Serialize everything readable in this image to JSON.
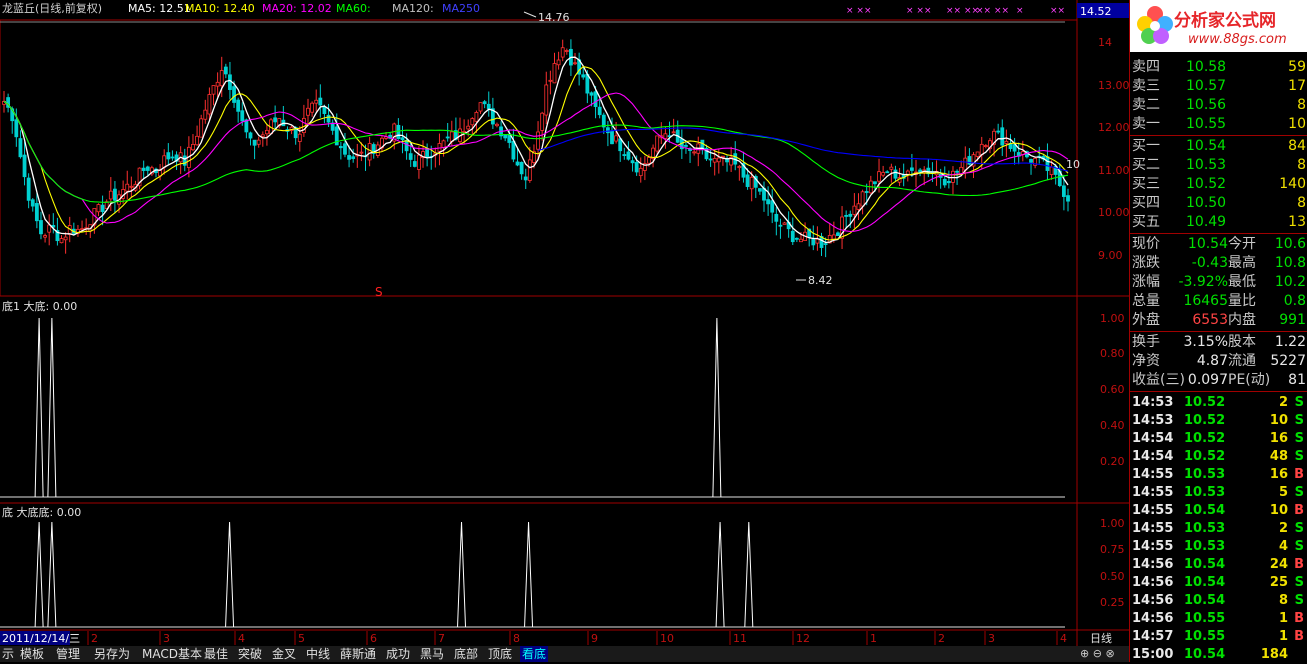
{
  "header": {
    "title": "龙蓝丘(日线,前复权)",
    "ma5": "MA5: 12.51",
    "ma10": "MA10: 12.40",
    "ma20": "MA20: 12.02",
    "ma60": "MA60:",
    "ma120": "MA120:",
    "ma250": "MA250",
    "price_box": "14.52"
  },
  "main_chart": {
    "y_ticks": [
      "14",
      "13.00",
      "12.00",
      "11.00",
      "10.00",
      "9.00"
    ],
    "high_label": "14.76",
    "low_label": "8.42",
    "right_label": "10",
    "s_marker": "S"
  },
  "sub1": {
    "title": "底1 大底: 0.00",
    "y_ticks": [
      "1.00",
      "0.80",
      "0.60",
      "0.40",
      "0.20"
    ]
  },
  "sub2": {
    "title": "底 大底底: 0.00",
    "y_ticks": [
      "1.00",
      "0.75",
      "0.50",
      "0.25"
    ]
  },
  "x_axis": {
    "date_box": "2011/12/14/三",
    "ticks": [
      "2",
      "3",
      "4",
      "5",
      "6",
      "7",
      "8",
      "9",
      "10",
      "11",
      "12",
      "1",
      "2",
      "3",
      "4"
    ],
    "period": "日线"
  },
  "logo": {
    "brand": "分析家公式网",
    "url": "www.88gs.com"
  },
  "order_book": {
    "asks": [
      {
        "label": "卖四",
        "price": "10.58",
        "vol": "59"
      },
      {
        "label": "卖三",
        "price": "10.57",
        "vol": "17"
      },
      {
        "label": "卖二",
        "price": "10.56",
        "vol": "8"
      },
      {
        "label": "卖一",
        "price": "10.55",
        "vol": "10"
      }
    ],
    "bids": [
      {
        "label": "买一",
        "price": "10.54",
        "vol": "84"
      },
      {
        "label": "买二",
        "price": "10.53",
        "vol": "8"
      },
      {
        "label": "买三",
        "price": "10.52",
        "vol": "140"
      },
      {
        "label": "买四",
        "price": "10.50",
        "vol": "8"
      },
      {
        "label": "买五",
        "price": "10.49",
        "vol": "13"
      }
    ]
  },
  "stats": [
    {
      "l1": "现价",
      "v1": "10.54",
      "l2": "今开",
      "v2": "10.6"
    },
    {
      "l1": "涨跌",
      "v1": "-0.43",
      "l2": "最高",
      "v2": "10.8"
    },
    {
      "l1": "涨幅",
      "v1": "-3.92%",
      "l2": "最低",
      "v2": "10.2"
    },
    {
      "l1": "总量",
      "v1": "16465",
      "l2": "量比",
      "v2": "0.8"
    },
    {
      "l1": "外盘",
      "v1": "6553",
      "l2": "内盘",
      "v2": "991"
    }
  ],
  "stats2": [
    {
      "l1": "换手",
      "v1": "3.15%",
      "l2": "股本",
      "v2": "1.22"
    },
    {
      "l1": "净资",
      "v1": "4.87",
      "l2": "流通",
      "v2": "5227"
    },
    {
      "l1": "收益(三)",
      "v1": "0.097",
      "l2": "PE(动)",
      "v2": "81"
    }
  ],
  "ticks": [
    {
      "time": "14:53",
      "price": "10.52",
      "vol": "2",
      "side": "S"
    },
    {
      "time": "14:53",
      "price": "10.52",
      "vol": "10",
      "side": "S"
    },
    {
      "time": "14:54",
      "price": "10.52",
      "vol": "16",
      "side": "S"
    },
    {
      "time": "14:54",
      "price": "10.52",
      "vol": "48",
      "side": "S"
    },
    {
      "time": "14:55",
      "price": "10.53",
      "vol": "16",
      "side": "B"
    },
    {
      "time": "14:55",
      "price": "10.53",
      "vol": "5",
      "side": "S"
    },
    {
      "time": "14:55",
      "price": "10.54",
      "vol": "10",
      "side": "B"
    },
    {
      "time": "14:55",
      "price": "10.53",
      "vol": "2",
      "side": "S"
    },
    {
      "time": "14:55",
      "price": "10.53",
      "vol": "4",
      "side": "S"
    },
    {
      "time": "14:56",
      "price": "10.54",
      "vol": "24",
      "side": "B"
    },
    {
      "time": "14:56",
      "price": "10.54",
      "vol": "25",
      "side": "S"
    },
    {
      "time": "14:56",
      "price": "10.54",
      "vol": "8",
      "side": "S"
    },
    {
      "time": "14:56",
      "price": "10.55",
      "vol": "1",
      "side": "B"
    },
    {
      "time": "14:57",
      "price": "10.55",
      "vol": "1",
      "side": "B"
    },
    {
      "time": "15:00",
      "price": "10.54",
      "vol": "184",
      "side": ""
    }
  ],
  "toolbar": {
    "buttons": [
      "示",
      "模板",
      "管理",
      "另存为",
      "MACD基本",
      "最佳",
      "突破",
      "金叉",
      "中线",
      "薛斯通",
      "成功",
      "黑马",
      "底部",
      "顶底",
      "看底"
    ],
    "active_index": 14
  },
  "colors": {
    "up": "#ff3030",
    "down": "#00d0d0",
    "ma5": "#ffffff",
    "ma10": "#ffff00",
    "ma20": "#ff00ff",
    "ma60": "#00ff00",
    "ma120": "#0000ff",
    "border": "#a00000"
  },
  "chart_data": {
    "type": "candlestick",
    "price_ylim": [
      8.2,
      14.9
    ],
    "close_path": [
      12.9,
      12.5,
      11.2,
      10.2,
      9.6,
      9.8,
      9.5,
      9.8,
      9.7,
      10.0,
      10.2,
      10.5,
      10.6,
      10.8,
      11.0,
      11.3,
      11.2,
      11.5,
      11.6,
      11.4,
      11.9,
      12.6,
      13.2,
      13.8,
      13.2,
      12.4,
      11.8,
      12.0,
      12.3,
      12.5,
      12.2,
      12.1,
      12.6,
      12.8,
      12.4,
      12.0,
      11.6,
      11.5,
      11.6,
      11.8,
      12.0,
      12.2,
      11.8,
      11.4,
      11.5,
      11.7,
      11.8,
      12.0,
      12.1,
      12.5,
      12.9,
      12.6,
      12.3,
      12.0,
      11.4,
      11.0,
      12.0,
      13.2,
      13.9,
      14.3,
      13.8,
      13.4,
      12.8,
      12.4,
      12.0,
      11.8,
      11.5,
      11.2,
      11.6,
      12.0,
      12.2,
      11.8,
      11.6,
      11.7,
      11.5,
      11.4,
      11.4,
      11.3,
      11.0,
      10.8,
      10.5,
      10.0,
      9.8,
      9.6,
      9.5,
      9.5,
      9.4,
      9.6,
      9.8,
      10.2,
      10.5,
      10.8,
      11.0,
      11.2,
      11.1,
      11.0,
      11.3,
      11.2,
      11.2,
      11.0,
      11.1,
      11.3,
      11.6,
      11.9,
      12.1,
      12.0,
      11.8,
      11.6,
      11.5,
      11.4,
      11.2,
      10.9,
      10.54
    ],
    "sub1_signals": [
      0.033,
      0.045,
      0.67
    ],
    "sub2_signals": [
      0.033,
      0.045,
      0.212,
      0.43,
      0.493,
      0.673,
      0.7
    ]
  }
}
